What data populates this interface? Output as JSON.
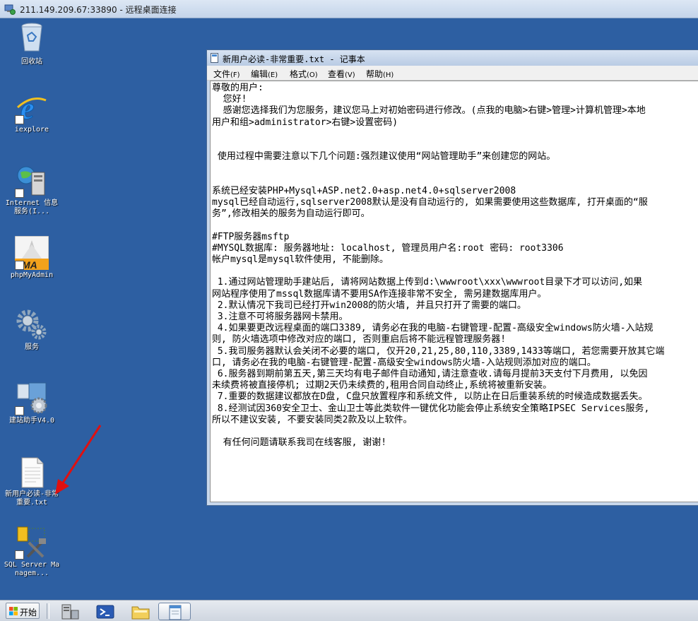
{
  "remote_desktop": {
    "title": "211.149.209.67:33890 - 远程桌面连接"
  },
  "desktop": {
    "icons": [
      {
        "label": "回收站"
      },
      {
        "label": "iexplore"
      },
      {
        "label": "Internet 信息服务(I..."
      },
      {
        "label": "phpMyAdmin"
      },
      {
        "label": "服务"
      },
      {
        "label": "建站助手V4.0"
      },
      {
        "label": "新用户必读-非常重要.txt"
      },
      {
        "label": "SQL Server Managem..."
      }
    ]
  },
  "notepad": {
    "title": "新用户必读-非常重要.txt - 记事本",
    "menu": [
      {
        "label": "文件",
        "accel": "(F)"
      },
      {
        "label": "编辑",
        "accel": "(E)"
      },
      {
        "label": "格式",
        "accel": "(O)"
      },
      {
        "label": "查看",
        "accel": "(V)"
      },
      {
        "label": "帮助",
        "accel": "(H)"
      }
    ],
    "content": "尊敬的用户:\n  您好!\n  感谢您选择我们为您服务，建议您马上对初始密码进行修改。(点我的电脑>右键>管理>计算机管理>本地\n用户和组>administrator>右键>设置密码)\n\n\n 使用过程中需要注意以下几个问题:强烈建议使用“网站管理助手”来创建您的网站。\n\n\n系统已经安装PHP+Mysql+ASP.net2.0+asp.net4.0+sqlserver2008\nmysql已经自动运行,sqlserver2008默认是没有自动运行的, 如果需要使用这些数据库, 打开桌面的“服\n务”,修改相关的服务为自动运行即可。\n\n#FTP服务器msftp\n#MYSQL数据库: 服务器地址: localhost, 管理员用户名:root 密码: root3306\n帐户mysql是mysql软件使用, 不能删除。\n\n 1.通过网站管理助手建站后, 请将网站数据上传到d:\\wwwroot\\xxx\\wwwroot目录下才可以访问,如果\n网站程序使用了mssql数据库请不要用SA作连接非常不安全, 需另建数据库用户。\n 2.默认情况下我司已经打开win2008的防火墙, 并且只打开了需要的端口。\n 3.注意不可将服务器网卡禁用。\n 4.如果要更改远程桌面的端口3389, 请务必在我的电脑-右键管理-配置-高级安全windows防火墙-入站规\n则, 防火墙选项中修改对应的端口, 否则重启后将不能远程管理服务器!\n 5.我司服务器默认会关闭不必要的端口, 仅开20,21,25,80,110,3389,1433等端口, 若您需要开放其它端\n口, 请务必在我的电脑-右键管理-配置-高级安全windows防火墙-入站规则添加对应的端口。\n 6.服务器到期前第五天,第三天均有电子邮件自动通知,请注意查收.请每月提前3天支付下月费用, 以免因\n未续费将被直接停机; 过期2天仍未续费的,租用合同自动终止,系统将被重新安装。\n 7.重要的数据建议都放在D盘, C盘只放置程序和系统文件, 以防止在日后重装系统的时候造成数据丢失。\n 8.经测试因360安全卫士、金山卫士等此类软件一键优化功能会停止系统安全策略IPSEC Services服务,\n所以不建议安装, 不要安装同类2款及以上软件。\n\n  有任何问题请联系我司在线客服, 谢谢!"
  },
  "taskbar": {
    "start_label": "开始",
    "buttons": [
      {
        "icon": "server-manager-icon"
      },
      {
        "icon": "powershell-icon"
      },
      {
        "icon": "explorer-folder-icon"
      },
      {
        "icon": "notepad-icon",
        "active": true
      }
    ]
  },
  "colors": {
    "desktop_bg": "#2d5fa2",
    "arrow": "#e01010"
  }
}
